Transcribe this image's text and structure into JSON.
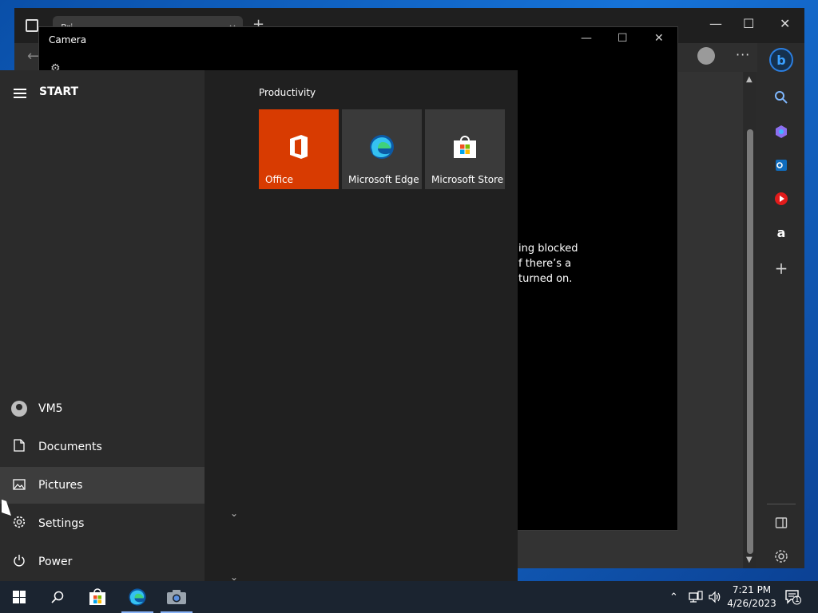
{
  "browser": {
    "tab_title": "Pri...",
    "tab_close": "×",
    "tab_add": "+",
    "back": "←",
    "minimize": "—",
    "maximize": "☐",
    "close": "✕",
    "more": "···",
    "sidebar_icons": [
      "bing-copilot-icon",
      "search-icon",
      "shopping-icon",
      "outlook-icon",
      "youtube-music-icon",
      "amazon-icon",
      "add-icon",
      "split-view-icon",
      "settings-icon"
    ]
  },
  "camera": {
    "title": "Camera",
    "minimize": "—",
    "maximize": "☐",
    "close": "✕",
    "message_lines": [
      "ing blocked",
      "f there’s a",
      "turned on."
    ]
  },
  "start": {
    "title": "START",
    "user": "VM5",
    "items": [
      {
        "label": "Documents",
        "icon": "document-icon"
      },
      {
        "label": "Pictures",
        "icon": "pictures-icon"
      },
      {
        "label": "Settings",
        "icon": "settings-icon"
      },
      {
        "label": "Power",
        "icon": "power-icon"
      }
    ],
    "group_title": "Productivity",
    "tiles": [
      {
        "label": "Office",
        "color": "#d83b01"
      },
      {
        "label": "Microsoft Edge",
        "color": "#3a3a3a"
      },
      {
        "label": "Microsoft Store",
        "color": "#3a3a3a"
      }
    ]
  },
  "taskbar": {
    "time": "7:21 PM",
    "date": "4/26/2023",
    "notification_count": "1",
    "accent": "#8ab4f8"
  }
}
